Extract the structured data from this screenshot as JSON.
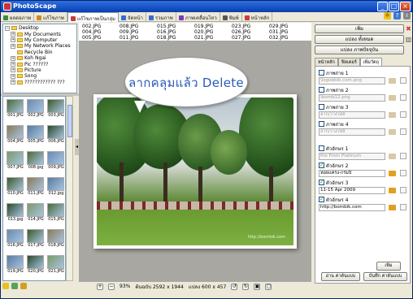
{
  "window": {
    "title": "PhotoScape"
  },
  "tabs": [
    {
      "label": "ผลดอภาพ",
      "color": "#3a8a3a"
    },
    {
      "label": "แก้ไขภาพ",
      "color": "#d08a1a"
    },
    {
      "label": "แก้ไขภาพเป็นกลุ่ม",
      "color": "#c83a3a"
    },
    {
      "label": "จัดหน้า",
      "color": "#3a6ad0"
    },
    {
      "label": "รวมภาพ",
      "color": "#3a6ad0"
    },
    {
      "label": "ภาพเคลื่อนไหว",
      "color": "#7a3ab8"
    },
    {
      "label": "พิมพ์",
      "color": "#555555"
    },
    {
      "label": "หน้าหลัก",
      "color": "#d03a3a"
    }
  ],
  "folder_tree": [
    {
      "label": "Desktop",
      "expander": "−",
      "depth": 0
    },
    {
      "label": "My Documents",
      "expander": "+",
      "depth": 1
    },
    {
      "label": "My Computer",
      "expander": "+",
      "depth": 1
    },
    {
      "label": "My Network Places",
      "expander": "+",
      "depth": 1
    },
    {
      "label": "Recycle Bin",
      "expander": "",
      "depth": 1
    },
    {
      "label": "Koh Ngai",
      "expander": "+",
      "depth": 1
    },
    {
      "label": "Pic ??????",
      "expander": "+",
      "depth": 1
    },
    {
      "label": "Picture",
      "expander": "+",
      "depth": 1
    },
    {
      "label": "Song",
      "expander": "+",
      "depth": 1
    },
    {
      "label": "???????????? ???",
      "expander": "+",
      "depth": 1
    }
  ],
  "thumbnails": [
    "001.JPG",
    "002.JPG",
    "003.JPG",
    "004.JPG",
    "005.JPG",
    "006.JPG",
    "007.JPG",
    "008.jpg",
    "009.JPG",
    "010.JPG",
    "011.JPG",
    "012.jpg",
    "013.jpg",
    "014.JPG",
    "015.JPG",
    "016.JPG",
    "017.JPG",
    "018.JPG",
    "019.JPG",
    "020.JPG",
    "021.JPG"
  ],
  "file_list": [
    [
      "002.JPG",
      "004.JPG",
      "005.JPG"
    ],
    [
      "008.JPG",
      "009.JPG",
      "011.JPG"
    ],
    [
      "015.JPG",
      "016.JPG",
      "018.JPG"
    ],
    [
      "019.JPG",
      "020.JPG",
      "021.JPG"
    ],
    [
      "023.JPG",
      "026.JPG",
      "027.JPG"
    ],
    [
      "029.JPG",
      "031.JPG",
      "032.JPG"
    ]
  ],
  "canvas": {
    "bubble_text": "ลากคลุมแล้ว Delete",
    "watermark": "http://bombik.com"
  },
  "statusbar": {
    "zoom": "93%",
    "original_size": "ต้นฉบับ 2592 x 1944",
    "converted_size": "แปลง 600 x 457"
  },
  "right_panel": {
    "add_button": "เพิ่ม",
    "convert_button": "แปลง ทั้งหมด",
    "convert_current_button": "แปลง ภาพปัจจุบัน",
    "tabs": [
      "หน้าหลัก",
      "ฟิลเตอร์",
      "เพิ่มวัตถุ"
    ],
    "image_rows": [
      {
        "label": "ภาพถ่าย 1",
        "checked": false,
        "value": "\\logobbik.com.png",
        "dim": true
      },
      {
        "label": "ภาพถ่าย 2",
        "checked": false,
        "value": "\\bomb12.png",
        "dim": true
      },
      {
        "label": "ภาพถ่าย 3",
        "checked": false,
        "value": "ลาก/วางไฟล์",
        "dim": true
      },
      {
        "label": "ภาพถ่าย 4",
        "checked": false,
        "value": "ลาก/วางไฟล์",
        "dim": true
      }
    ],
    "text_rows": [
      {
        "label": "ตัวอักษร 1",
        "checked": false,
        "value": "Pro From Platinum",
        "dim": true
      },
      {
        "label": "ตัวอักษร 2",
        "checked": true,
        "value": "หอยแครง-กรมป๊",
        "dim": false
      },
      {
        "label": "ตัวอักษร 3",
        "checked": true,
        "value": "11-15 Apr 2009",
        "dim": false
      },
      {
        "label": "ตัวอักษร 4",
        "checked": true,
        "value": "http://bombik.com",
        "dim": false
      }
    ],
    "bottom_add_button": "เพิ่ม",
    "load_button": "อ่าน ค่าต้นแบบ",
    "save_button": "บันทึก ค่าต้นแบบ"
  }
}
